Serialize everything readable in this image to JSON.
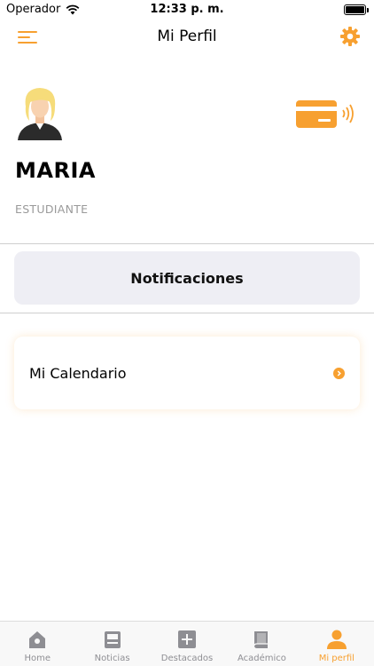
{
  "status_bar": {
    "carrier": "Operador",
    "time": "12:33 p. m."
  },
  "nav": {
    "title": "Mi Perfil",
    "menu_icon": "menu-icon",
    "settings_icon": "gear-icon"
  },
  "profile": {
    "name": "MARIA",
    "role": "ESTUDIANTE",
    "avatar_icon": "avatar",
    "card_icon": "contactless-card-icon"
  },
  "notifications": {
    "label": "Notificaciones"
  },
  "calendar": {
    "label": "Mi Calendario",
    "icon": "chevron-right-icon"
  },
  "tabs": [
    {
      "label": "Home",
      "icon": "home-icon",
      "active": false
    },
    {
      "label": "Noticias",
      "icon": "news-icon",
      "active": false
    },
    {
      "label": "Destacados",
      "icon": "plus-icon",
      "active": false
    },
    {
      "label": "Académico",
      "icon": "book-icon",
      "active": false
    },
    {
      "label": "Mi perfil",
      "icon": "person-icon",
      "active": true
    }
  ],
  "colors": {
    "accent": "#f7a030",
    "tab_inactive": "#8e8e93",
    "button_bg": "#eeeef4"
  }
}
